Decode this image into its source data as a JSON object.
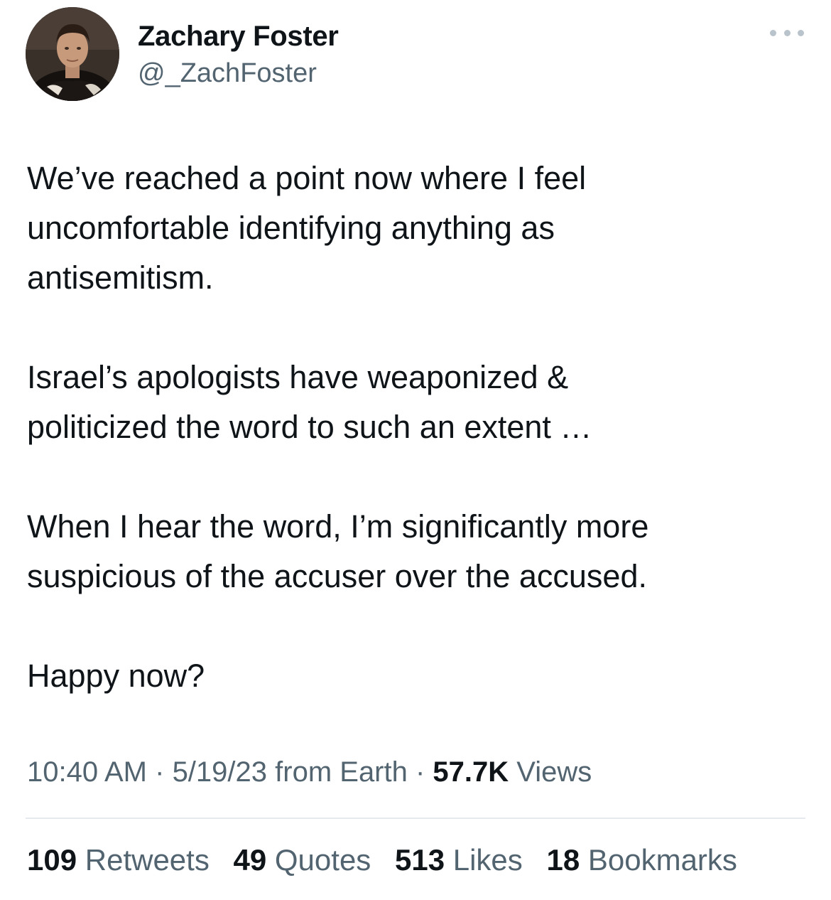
{
  "author": {
    "display_name": "Zachary Foster",
    "handle": "@_ZachFoster",
    "avatar_icon": "profile-photo"
  },
  "more_icon": "more-horizontal-icon",
  "tweet": {
    "paragraphs": [
      "We’ve reached a point now where I feel\nuncomfortable identifying anything as\nantisemitism.",
      "Israel’s apologists have weaponized &\npoliticized the word to such an extent …",
      "When I hear the word, I’m significantly more\nsuspicious of the accuser over the accused.",
      "Happy now?"
    ]
  },
  "meta": {
    "time": "10:40 AM",
    "sep1": " · ",
    "date": "5/19/23",
    "source": " from Earth",
    "sep2": " · ",
    "views_count": "57.7K",
    "views_label": " Views"
  },
  "stats": {
    "retweets": {
      "count": "109",
      "label": "Retweets"
    },
    "quotes": {
      "count": "49",
      "label": "Quotes"
    },
    "likes": {
      "count": "513",
      "label": "Likes"
    },
    "bookmarks": {
      "count": "18",
      "label": "Bookmarks"
    }
  },
  "colors": {
    "text": "#0f1419",
    "secondary": "#536471",
    "divider": "#e6eaee"
  }
}
